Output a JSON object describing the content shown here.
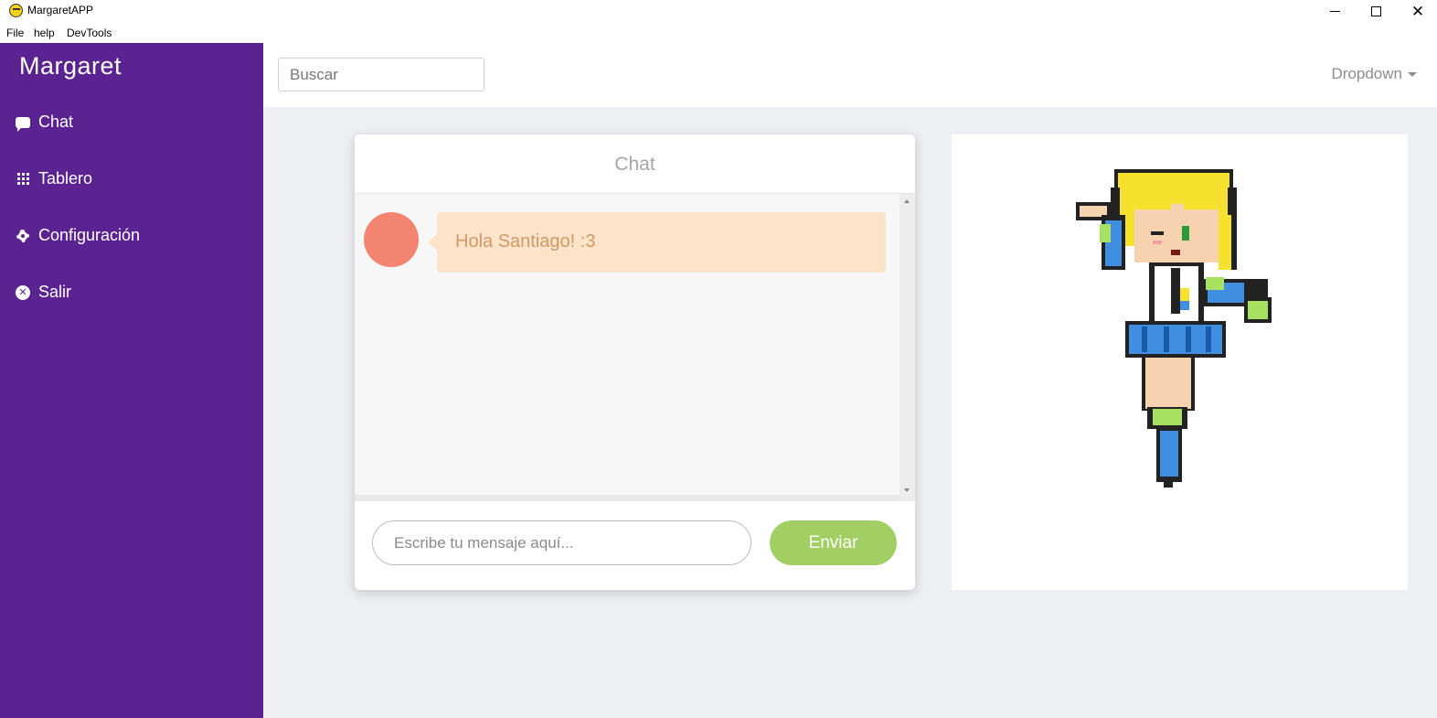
{
  "window": {
    "title": "MargaretAPP",
    "close_glyph": "✕"
  },
  "menu": {
    "items": [
      "File",
      "help",
      "DevTools"
    ]
  },
  "sidebar": {
    "brand": "Margaret",
    "items": [
      {
        "label": "Chat",
        "icon": "chat-bubble-icon"
      },
      {
        "label": "Tablero",
        "icon": "grid-icon"
      },
      {
        "label": "Configuración",
        "icon": "gear-icon"
      },
      {
        "label": "Salir",
        "icon": "close-circle-icon"
      }
    ]
  },
  "topbar": {
    "search_placeholder": "Buscar",
    "dropdown_label": "Dropdown"
  },
  "chat": {
    "header": "Chat",
    "messages": [
      {
        "text": "Hola Santiago! :3"
      }
    ],
    "input_placeholder": "Escribe tu mensaje aquí...",
    "send_label": "Enviar"
  },
  "colors": {
    "sidebar": "#5b2392",
    "send_button": "#a1cf63",
    "avatar": "#f3846f",
    "bubble": "#fde3c9"
  }
}
